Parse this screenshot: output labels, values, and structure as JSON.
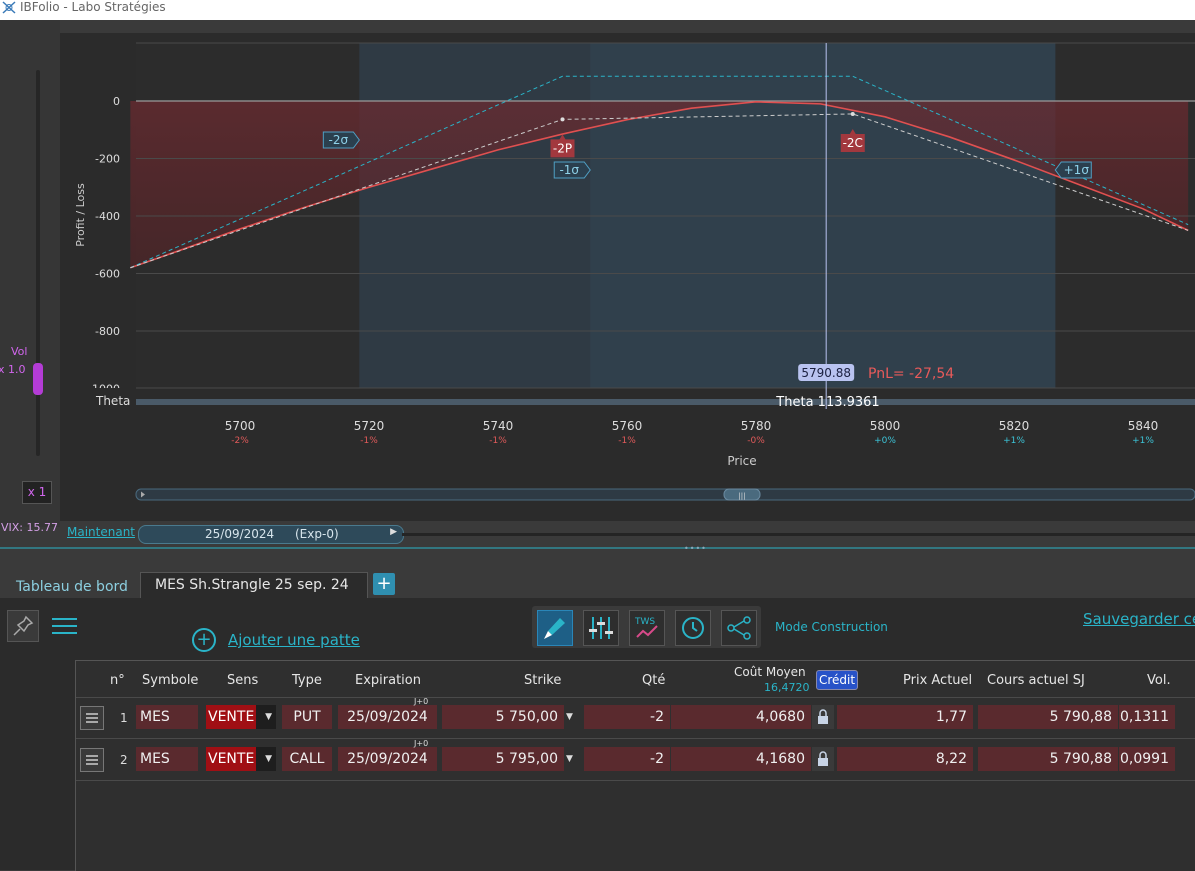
{
  "window": {
    "title": "IBFolio - Labo Stratégies"
  },
  "left": {
    "vol_label": "Vol",
    "vol_mult": "x 1.0",
    "x1_label": "x 1",
    "vix_label": "VIX: 15.77"
  },
  "chart_data": {
    "type": "line",
    "ylabel": "Profit / Loss",
    "xlabel": "Price",
    "xlim": [
      5683,
      5847
    ],
    "ylim": [
      -1000,
      200
    ],
    "y_ticks": [
      0,
      -200,
      -400,
      -600,
      -800,
      -1000
    ],
    "y_tick_labels": [
      "0",
      "-200",
      "-400",
      "-600",
      "-800",
      "-1000"
    ],
    "x_ticks": [
      5700,
      5720,
      5740,
      5760,
      5780,
      5800,
      5820,
      5840
    ],
    "x_tick_labels": [
      "5700",
      "5720",
      "5740",
      "5760",
      "5780",
      "5800",
      "5820",
      "5840"
    ],
    "x_pct_labels": [
      "-2%",
      "-1%",
      "-1%",
      "-1%",
      "-0%",
      "+0%",
      "+1%",
      "+1%"
    ],
    "series": [
      {
        "values_x": [
          5683,
          5690,
          5700,
          5710,
          5720,
          5730,
          5740,
          5750,
          5760,
          5770,
          5780,
          5790,
          5800,
          5810,
          5820,
          5830,
          5840,
          5847
        ],
        "values_y": [
          -580,
          -525,
          -445,
          -370,
          -300,
          -235,
          -170,
          -115,
          -65,
          -25,
          -3,
          -10,
          -55,
          -125,
          -205,
          -290,
          -375,
          -450
        ],
        "color": "#e05050"
      },
      {
        "values_x": [
          5683,
          5750,
          5795,
          5847
        ],
        "values_y": [
          -580,
          86,
          86,
          -430
        ],
        "color": "#2ab4c8"
      },
      {
        "values_x": [
          5683,
          5750,
          5795,
          5847
        ],
        "values_y": [
          -580,
          -64,
          -45,
          -450
        ],
        "color": "#cccccc"
      }
    ],
    "sigma_bands": [
      {
        "label": "-2σ",
        "x": 5718.5
      },
      {
        "label": "-1σ",
        "x": 5754.3
      },
      {
        "label": "+1σ",
        "x": 5826.4
      }
    ],
    "strike_markers": [
      {
        "label": "-2P",
        "x": 5750,
        "y": -64
      },
      {
        "label": "-2C",
        "x": 5795,
        "y": -45
      }
    ],
    "cursor": {
      "price": 5790.88,
      "price_label": "5790.88",
      "pnl_label": "PnL= -27,54"
    },
    "theta_label": "Theta",
    "theta_value": "Theta 113.9361"
  },
  "timeline": {
    "now_label": "Maintenant",
    "date": "25/09/2024",
    "exp": "(Exp-0)"
  },
  "tabs": [
    {
      "label": "Tableau de bord"
    },
    {
      "label": "MES Sh.Strangle 25 sep. 24"
    }
  ],
  "toolbar": {
    "add_leg": "Ajouter une patte",
    "mode": "Mode Construction",
    "save": "Sauvegarder ce"
  },
  "table": {
    "headers": [
      "n°",
      "Symbole",
      "Sens",
      "Type",
      "Expiration",
      "Strike",
      "Qté",
      "Coût Moyen",
      "Prix Actuel",
      "Cours actuel SJ",
      "Vol."
    ],
    "cost_sub": "16,4720",
    "credit_label": "Crédit",
    "j0": "J+0",
    "rows": [
      {
        "n": "1",
        "symbol": "MES",
        "sens": "VENTE",
        "type": "PUT",
        "exp": "25/09/2024",
        "strike": "5 750,00",
        "qty": "-2",
        "cost": "4,0680",
        "price": "1,77",
        "underlying": "5 790,88",
        "vol": "0,1311"
      },
      {
        "n": "2",
        "symbol": "MES",
        "sens": "VENTE",
        "type": "CALL",
        "exp": "25/09/2024",
        "strike": "5 795,00",
        "qty": "-2",
        "cost": "4,1680",
        "price": "8,22",
        "underlying": "5 790,88",
        "vol": "0,0991"
      }
    ]
  }
}
